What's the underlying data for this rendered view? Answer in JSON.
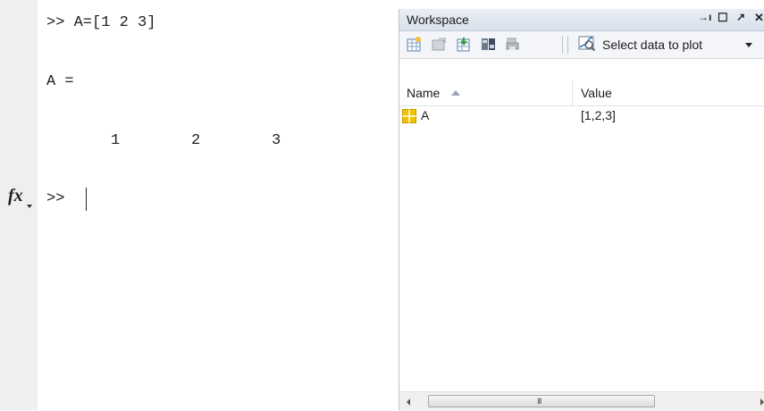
{
  "command_window": {
    "lines": [
      ">> A=[1 2 3]",
      "A =",
      "1",
      "2",
      "3"
    ],
    "prompt": ">>"
  },
  "workspace": {
    "title": "Workspace",
    "controls": {
      "undock": "→ı",
      "maximize": "☐",
      "restore": "↗",
      "close": "✕"
    },
    "toolbar": {
      "buttons": [
        "new-variable-icon",
        "open-variable-icon",
        "import-data-icon",
        "save-workspace-icon",
        "print-icon"
      ],
      "plot_select_label": "Select data to plot"
    },
    "columns": {
      "name": "Name",
      "value": "Value"
    },
    "variables": [
      {
        "name": "A",
        "value": "[1,2,3]",
        "icon": "matrix-icon"
      }
    ],
    "scrollbar_grip": "III"
  },
  "colors": {
    "titlebar": "#dfe6ef",
    "gutter": "#efefef",
    "matrix_icon": "#f2c200"
  }
}
